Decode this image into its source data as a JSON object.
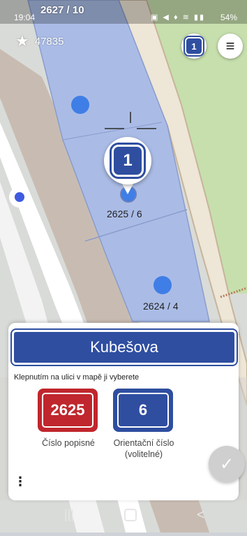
{
  "status_bar": {
    "time": "19:04",
    "overlay_label": "2627 / 10",
    "battery": "54%"
  },
  "map": {
    "score": "47835",
    "house_labels": {
      "selected": "2625 / 6",
      "neighbor": "2624 / 4"
    },
    "pin_badge": "1",
    "menu_badge": "1",
    "menu_icon": "≡"
  },
  "sheet": {
    "street_name": "Kubešova",
    "hint": "Klepnutím na ulici v mapě ji vyberete",
    "popisne_value": "2625",
    "popisne_label": "Číslo popisné",
    "orientacni_value": "6",
    "orientacni_label_line1": "Orientační číslo",
    "orientacni_label_line2": "(volitelné)",
    "more_icon": "⋮",
    "confirm_icon": "✓"
  },
  "colors": {
    "plate_red": "#c0262d",
    "plate_blue": "#2f4ea0",
    "building_fill": "#aabce6",
    "park_green": "#c7dfad",
    "map_dot": "#3f7ee6"
  },
  "navbar": {
    "recents_icon": "|||",
    "back_icon": "<"
  }
}
